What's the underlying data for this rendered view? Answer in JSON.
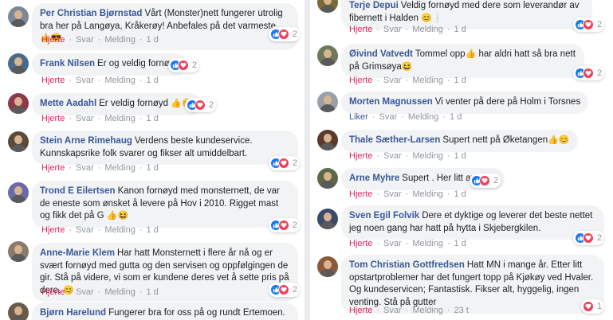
{
  "left_comments": [
    {
      "name": "Per Christian Bjørnstad",
      "text": "Vårt (Monster)nett fungerer utrolig bra her på Langøya, Kråkerøy! Anbefales på det varmeste",
      "emoji": "👍😎",
      "actions": {
        "like": "Hjerte",
        "reply": "Svar",
        "msg": "Melding",
        "time": "1 d"
      },
      "reactions": 2,
      "avatar_color": "#7a8a9a"
    },
    {
      "name": "Frank Nilsen",
      "text": "Er og veldig fornøyd",
      "emoji": "",
      "actions": {
        "like": "Hjerte",
        "reply": "Svar",
        "msg": "Melding",
        "time": "1 d"
      },
      "reactions": 2,
      "avatar_color": "#4a6a8a"
    },
    {
      "name": "Mette Aadahl",
      "text": "Er veldig fornøyd",
      "emoji": "👍😊",
      "actions": {
        "like": "Hjerte",
        "reply": "Svar",
        "msg": "Melding",
        "time": "1 d"
      },
      "reactions": 2,
      "avatar_color": "#8a3a4a"
    },
    {
      "name": "Stein Arne Rimehaug",
      "text": "Verdens beste kundeservice. Kunnskapsrike folk svarer og fikser alt umiddelbart.",
      "emoji": "",
      "actions": {
        "like": "Hjerte",
        "reply": "Svar",
        "msg": "Melding",
        "time": "1 d"
      },
      "reactions": 2,
      "avatar_color": "#5a4a3a"
    },
    {
      "name": "Trond E Eilertsen",
      "text": "Kanon fornøyd med monsternett, de var de eneste som ønsket å levere på Hov i 2010. Rigget mast og fikk det på G",
      "emoji": "👍😆",
      "actions": {
        "like": "Hjerte",
        "reply": "Svar",
        "msg": "Melding",
        "time": "1 d"
      },
      "reactions": 2,
      "avatar_color": "#6a6aaa"
    },
    {
      "name": "Anne-Marie Klem",
      "text": "Har hatt Monsternett i flere år nå og er svært fornøyd med gutta og den servisen og oppfølgingen de gir. Stå på videre, vi som er kundene deres vet å sette pris på dere.",
      "emoji": "😊",
      "actions": {
        "like": "Hjerte",
        "reply": "Svar",
        "msg": "Melding",
        "time": "1 d"
      },
      "reactions": 2,
      "avatar_color": "#8a7a6a"
    },
    {
      "name": "Bjørn Harelund",
      "text": "Fungerer bra for oss på og rundt Ertemoen. Setter",
      "emoji": "",
      "avatar_color": "#6a5a4a"
    }
  ],
  "right_comments": [
    {
      "name": "Terje Depui",
      "text": "Veldig fornøyd med dere som leverandør av fibernett i Halden",
      "emoji": "😊❕",
      "actions": {
        "like": "Hjerte",
        "reply": "Svar",
        "msg": "Melding",
        "time": "1 d"
      },
      "reactions": 2,
      "avatar_color": "#7a6a3a"
    },
    {
      "name": "Øivind Vatvedt",
      "text": "Tommel opp",
      "text2": "har aldri hatt så bra nett på Grimsøya",
      "emoji": "👍",
      "emoji2": "😆",
      "actions": {
        "like": "Hjerte",
        "reply": "Svar",
        "msg": "Melding",
        "time": "1 d"
      },
      "reactions": 2,
      "avatar_color": "#6a7a5a"
    },
    {
      "name": "Morten Magnussen",
      "text": "Vi venter på dere på Holm i Torsnes",
      "emoji": "",
      "actions": {
        "like": "Liker",
        "reply": "Svar",
        "msg": "Melding",
        "time": "1 d"
      },
      "reactions": 0,
      "avatar_color": "#9aa0a8"
    },
    {
      "name": "Thale Sæther-Larsen",
      "text": "Supert nett på Øketangen",
      "emoji": "👍😊",
      "actions": {
        "like": "Hjerte",
        "reply": "Svar",
        "msg": "Melding",
        "time": "1 d"
      },
      "reactions": 0,
      "avatar_color": "#5a3a2a"
    },
    {
      "name": "Arne Myhre",
      "text": "Supert . Her litt avsides",
      "emoji": "",
      "actions": {
        "like": "Hjerte",
        "reply": "Svar",
        "msg": "Melding",
        "time": "1 d"
      },
      "reactions": 2,
      "avatar_color": "#5a6a4a"
    },
    {
      "name": "Sven Egil Folvik",
      "text": "Dere et dyktige og leverer det beste nettet jeg noen gang har hatt på hytta i Skjebergkilen.",
      "emoji": "",
      "actions": {
        "like": "Hjerte",
        "reply": "Svar",
        "msg": "Melding",
        "time": "1 d"
      },
      "reactions": 2,
      "avatar_color": "#3a4a6a"
    },
    {
      "name": "Tom Christian Gottfredsen",
      "text": "Hatt MN i mange år. Etter litt opstartproblemer har det fungert topp på Kjøkøy ved Hvaler. Og kundeservicen; Fantastisk. Fikser alt, hyggelig, ingen venting. Stå på gutter",
      "emoji": "",
      "actions": {
        "like": "Hjerte",
        "reply": "Svar",
        "msg": "Melding",
        "time": "23 t"
      },
      "reactions": 1,
      "avatar_color": "#8a5a3a"
    }
  ],
  "colors": {
    "name": "#385898",
    "heart": "#e0245e",
    "bubble": "#f2f3f5",
    "meta": "#90949c"
  }
}
